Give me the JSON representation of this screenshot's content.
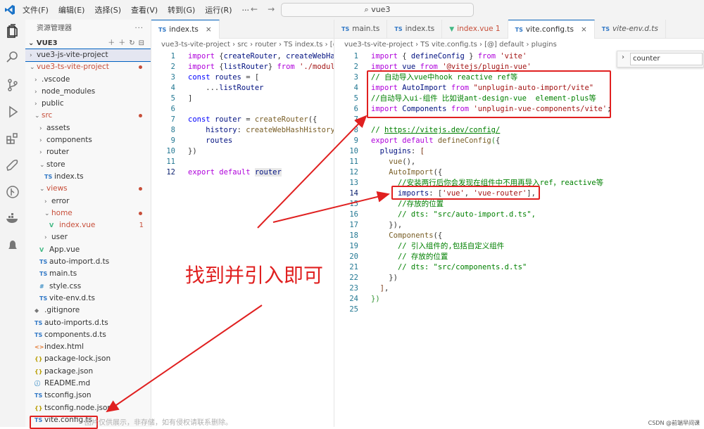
{
  "titlebar": {
    "menus": [
      "文件(F)",
      "编辑(E)",
      "选择(S)",
      "查看(V)",
      "转到(G)",
      "运行(R)",
      "···"
    ],
    "search": "vue3"
  },
  "sidebar": {
    "title": "资源管理器",
    "section": "VUE3",
    "tree": [
      {
        "label": "vue3-js-vite-project",
        "depth": 0,
        "chev": "›",
        "sel": true
      },
      {
        "label": "vue3-ts-vite-project",
        "depth": 0,
        "chev": "⌄",
        "err": true,
        "dot": true
      },
      {
        "label": ".vscode",
        "depth": 1,
        "chev": "›"
      },
      {
        "label": "node_modules",
        "depth": 1,
        "chev": "›"
      },
      {
        "label": "public",
        "depth": 1,
        "chev": "›"
      },
      {
        "label": "src",
        "depth": 1,
        "chev": "⌄",
        "err": true,
        "dot": true
      },
      {
        "label": "assets",
        "depth": 2,
        "chev": "›"
      },
      {
        "label": "components",
        "depth": 2,
        "chev": "›"
      },
      {
        "label": "router",
        "depth": 2,
        "chev": "›"
      },
      {
        "label": "store",
        "depth": 2,
        "chev": "⌄"
      },
      {
        "label": "index.ts",
        "depth": 3,
        "icon": "TS"
      },
      {
        "label": "views",
        "depth": 2,
        "chev": "⌄",
        "err": true,
        "dot": true
      },
      {
        "label": "error",
        "depth": 3,
        "chev": "›"
      },
      {
        "label": "home",
        "depth": 3,
        "chev": "⌄",
        "err": true,
        "dot": true
      },
      {
        "label": "index.vue",
        "depth": 4,
        "icon": "V",
        "err": true,
        "badge": "1"
      },
      {
        "label": "user",
        "depth": 3,
        "chev": "›"
      },
      {
        "label": "App.vue",
        "depth": 2,
        "icon": "V"
      },
      {
        "label": "auto-import.d.ts",
        "depth": 2,
        "icon": "TS"
      },
      {
        "label": "main.ts",
        "depth": 2,
        "icon": "TS"
      },
      {
        "label": "style.css",
        "depth": 2,
        "icon": "#"
      },
      {
        "label": "vite-env.d.ts",
        "depth": 2,
        "icon": "TS"
      },
      {
        "label": ".gitignore",
        "depth": 1,
        "icon": "◆"
      },
      {
        "label": "auto-imports.d.ts",
        "depth": 1,
        "icon": "TS"
      },
      {
        "label": "components.d.ts",
        "depth": 1,
        "icon": "TS"
      },
      {
        "label": "index.html",
        "depth": 1,
        "icon": "<>"
      },
      {
        "label": "package-lock.json",
        "depth": 1,
        "icon": "{}"
      },
      {
        "label": "package.json",
        "depth": 1,
        "icon": "{}"
      },
      {
        "label": "README.md",
        "depth": 1,
        "icon": "ⓘ"
      },
      {
        "label": "tsconfig.json",
        "depth": 1,
        "icon": "TS"
      },
      {
        "label": "tsconfig.node.json",
        "depth": 1,
        "icon": "{}"
      },
      {
        "label": "vite.config.ts",
        "depth": 1,
        "icon": "TS"
      }
    ]
  },
  "left_editor": {
    "tab": "index.ts",
    "breadcrumb": "vue3-ts-vite-project › src › router › TS index.ts › [@] ro",
    "lines": [
      {
        "n": "1",
        "html": "<span class='kw2'>import</span> {<span class='var'>createRouter</span>, <span class='var'>createWebHas</span>"
      },
      {
        "n": "2",
        "html": "<span class='kw2'>import</span> {<span class='var'>listRouter</span>} <span class='kw2'>from</span> <span class='str'>'./module</span>"
      },
      {
        "n": "3",
        "html": "<span class='kw'>const</span> <span class='var'>routes</span> = ["
      },
      {
        "n": "4",
        "html": "    ...<span class='var'>listRouter</span>"
      },
      {
        "n": "5",
        "html": "]"
      },
      {
        "n": "6",
        "html": ""
      },
      {
        "n": "7",
        "html": "<span class='kw'>const</span> <span class='var'>router</span> = <span class='fn'>createRouter</span>({"
      },
      {
        "n": "8",
        "html": "    <span class='var'>history</span>: <span class='fn'>createWebHashHistory</span>("
      },
      {
        "n": "9",
        "html": "    <span class='var'>routes</span>"
      },
      {
        "n": "10",
        "html": "})"
      },
      {
        "n": "11",
        "html": ""
      },
      {
        "n": "12",
        "html": "<span class='kw2'>export</span> <span class='kw2'>default</span> <span class='var' style='background:#e8e8e8'>router</span>",
        "cur": true
      }
    ]
  },
  "right_editor": {
    "tabs": [
      {
        "label": "main.ts",
        "kind": "ts"
      },
      {
        "label": "index.ts",
        "kind": "ts"
      },
      {
        "label": "index.vue 1",
        "kind": "vue"
      },
      {
        "label": "vite.config.ts",
        "kind": "ts",
        "active": true
      },
      {
        "label": "vite-env.d.ts",
        "kind": "ts"
      }
    ],
    "breadcrumb": "vue3-ts-vite-project › TS vite.config.ts › [@] default › plugins",
    "find_value": "counter",
    "lines": [
      {
        "n": "1",
        "html": "<span class='kw2'>import</span> { <span class='var'>defineConfig</span> } <span class='kw2'>from</span> <span class='str'>'vite'</span>"
      },
      {
        "n": "2",
        "html": "<span class='kw2'>import</span> <span class='var'>vue</span> <span class='kw2'>from</span> <span class='str'>'@vitejs/plugin-vue'</span>"
      },
      {
        "n": "3",
        "html": "<span class='com'>// 自动导入vue中hook reactive ref等</span>"
      },
      {
        "n": "4",
        "html": "<span class='kw2'>import</span> <span class='var'>AutoImport</span> <span class='kw2'>from</span> <span class='str'>\"unplugin-auto-import/vite\"</span>"
      },
      {
        "n": "5",
        "html": "<span class='com'>//自动导入ui-组件 比如说ant-design-vue  element-plus等</span>"
      },
      {
        "n": "6",
        "html": "<span class='kw2'>import</span> <span class='var'>Components</span> <span class='kw2'>from</span> <span class='str'>'unplugin-vue-components/vite'</span>;"
      },
      {
        "n": "7",
        "html": ""
      },
      {
        "n": "8",
        "html": "<span class='com'>// <u>https://vitejs.dev/config/</u></span>"
      },
      {
        "n": "9",
        "html": "<span class='kw2'>export</span> <span class='kw2'>default</span> <span class='fn'>defineConfig</span><span class='br'>(</span>{"
      },
      {
        "n": "10",
        "html": "  <span class='var'>plugins</span>: <span class='br2'>[</span>"
      },
      {
        "n": "11",
        "html": "    <span class='fn'>vue</span>(),"
      },
      {
        "n": "12",
        "html": "    <span class='fn'>AutoImport</span>({"
      },
      {
        "n": "13",
        "html": "      <span class='com'>//安装两行后你会发现在组件中不用再导入ref，reactive等</span>"
      },
      {
        "n": "14",
        "html": "      <span class='var'>imports</span>: [<span class='str'>'vue'</span>, <span class='str'>'vue-router'</span>],",
        "cur": true
      },
      {
        "n": "15",
        "html": "      <span class='com'>//存放的位置</span>"
      },
      {
        "n": "16",
        "html": "      <span class='com'>// dts: \"src/auto-import.d.ts\",</span>"
      },
      {
        "n": "17",
        "html": "    }),"
      },
      {
        "n": "18",
        "html": "    <span class='fn'>Components</span>({"
      },
      {
        "n": "19",
        "html": "      <span class='com'>// 引入组件的,包括自定义组件</span>"
      },
      {
        "n": "20",
        "html": "      <span class='com'>// 存放的位置</span>"
      },
      {
        "n": "21",
        "html": "      <span class='com'>// dts: \"src/components.d.ts\"</span>"
      },
      {
        "n": "22",
        "html": "    })"
      },
      {
        "n": "23",
        "html": "  <span class='br2'>]</span>,"
      },
      {
        "n": "24",
        "html": "<span class='br'>})</span>"
      },
      {
        "n": "25",
        "html": ""
      }
    ]
  },
  "annotation": {
    "text": "找到并引入即可",
    "color": "#e02020"
  },
  "watermark": "图片仅供展示，非存储，如有侵权请联系删除。",
  "credit": "CSDN @前端早间课"
}
